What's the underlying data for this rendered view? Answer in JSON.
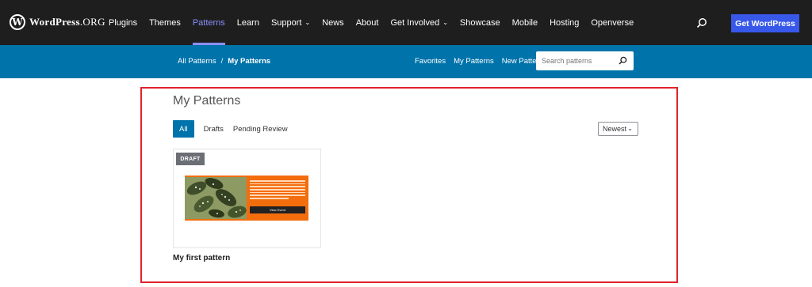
{
  "header": {
    "logo_text": "WordPress",
    "logo_suffix": ".ORG",
    "nav": [
      {
        "label": "Plugins"
      },
      {
        "label": "Themes"
      },
      {
        "label": "Patterns",
        "active": true
      },
      {
        "label": "Learn"
      },
      {
        "label": "Support",
        "has_dropdown": true
      },
      {
        "label": "News"
      },
      {
        "label": "About"
      },
      {
        "label": "Get Involved",
        "has_dropdown": true
      },
      {
        "label": "Showcase"
      },
      {
        "label": "Mobile"
      },
      {
        "label": "Hosting"
      },
      {
        "label": "Openverse"
      }
    ],
    "cta_label": "Get WordPress",
    "accent_color": "#3858e9",
    "active_color": "#8c8fff"
  },
  "subnav": {
    "breadcrumb": {
      "root": "All Patterns",
      "separator": "/",
      "current": "My Patterns"
    },
    "links": [
      "Favorites",
      "My Patterns",
      "New Pattern"
    ],
    "search_placeholder": "Search patterns",
    "bg_color": "#0073aa"
  },
  "main": {
    "title": "My Patterns",
    "tabs": [
      {
        "label": "All",
        "active": true
      },
      {
        "label": "Drafts"
      },
      {
        "label": "Pending Review"
      }
    ],
    "sort": {
      "selected": "Newest"
    },
    "patterns": [
      {
        "status": "DRAFT",
        "title": "My first pattern",
        "preview_button": "View Event"
      }
    ],
    "highlight_color": "#e0232b"
  }
}
